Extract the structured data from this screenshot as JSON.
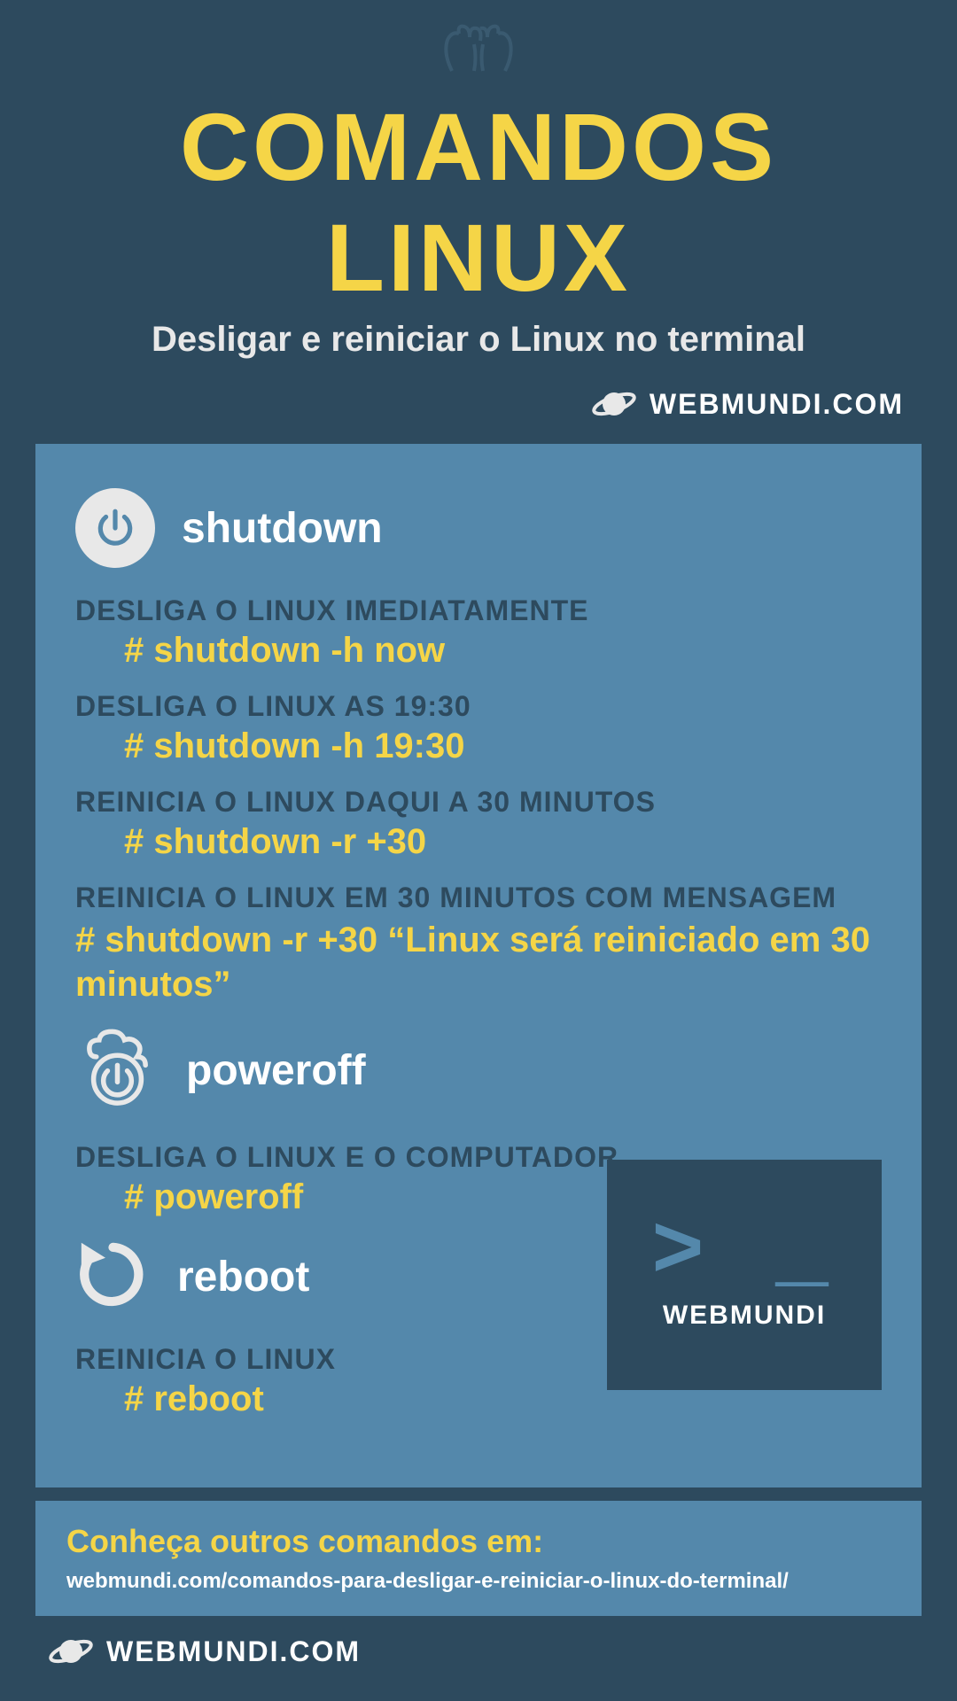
{
  "header": {
    "title": "COMANDOS LINUX",
    "subtitle": "Desligar e reiniciar o Linux no terminal",
    "brand": "WEBMUNDI.COM"
  },
  "sections": {
    "shutdown": {
      "label": "shutdown",
      "entries": [
        {
          "desc": "DESLIGA O LINUX IMEDIATAMENTE",
          "cmd": "# shutdown -h now"
        },
        {
          "desc": "DESLIGA O LINUX AS 19:30",
          "cmd": "# shutdown -h 19:30"
        },
        {
          "desc": "REINICIA O LINUX DAQUI A 30 MINUTOS",
          "cmd": "# shutdown -r +30"
        },
        {
          "desc": "REINICIA O LINUX EM 30 MINUTOS COM MENSAGEM",
          "cmd": "# shutdown -r +30 “Linux será reiniciado em 30 minutos”"
        }
      ]
    },
    "poweroff": {
      "label": "poweroff",
      "entries": [
        {
          "desc": "DESLIGA O LINUX E O COMPUTADOR",
          "cmd": "# poweroff"
        }
      ]
    },
    "reboot": {
      "label": "reboot",
      "entries": [
        {
          "desc": "REINICIA O LINUX",
          "cmd": "# reboot"
        }
      ]
    }
  },
  "badge": {
    "prompt": "> _",
    "text": "WEBMUNDI"
  },
  "footer": {
    "title": "Conheça outros comandos em:",
    "url": "webmundi.com/comandos-para-desligar-e-reiniciar-o-linux-do-terminal/",
    "brand": "WEBMUNDI.COM"
  }
}
